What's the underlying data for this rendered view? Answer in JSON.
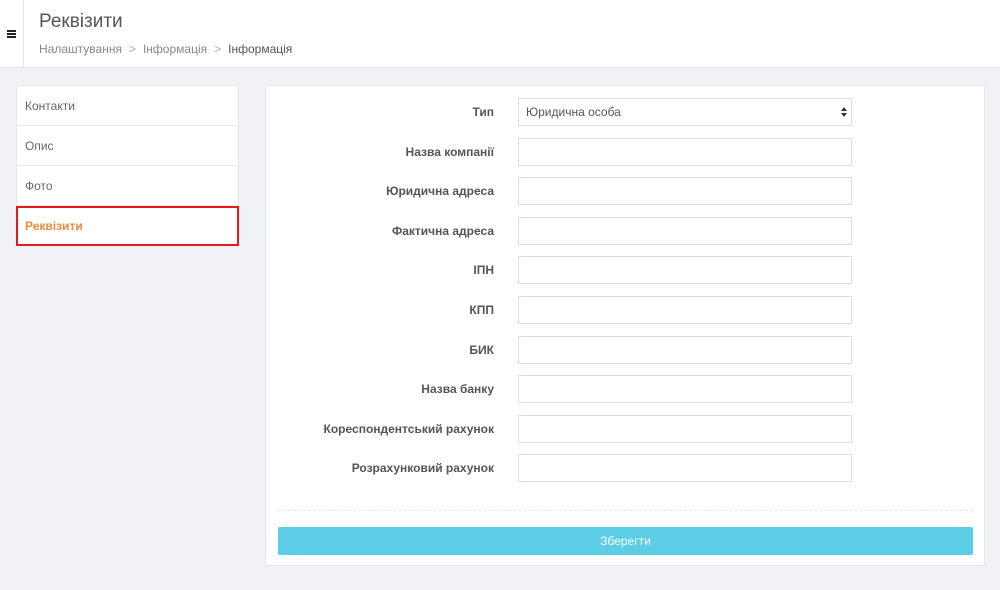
{
  "header": {
    "title": "Реквізити",
    "breadcrumb": [
      "Налаштування",
      "Інформація",
      "Інформація"
    ],
    "separator": ">",
    "menu_icon": "hamburger-icon"
  },
  "sidebar": {
    "items": [
      {
        "label": "Контакти",
        "active": false
      },
      {
        "label": "Опис",
        "active": false
      },
      {
        "label": "Фото",
        "active": false
      },
      {
        "label": "Реквізити",
        "active": true
      }
    ]
  },
  "form": {
    "type": {
      "label": "Тип",
      "value": "Юридична особа"
    },
    "fields": [
      {
        "label": "Назва компанії",
        "value": ""
      },
      {
        "label": "Юридична адреса",
        "value": ""
      },
      {
        "label": "Фактична адреса",
        "value": ""
      },
      {
        "label": "ІПН",
        "value": ""
      },
      {
        "label": "КПП",
        "value": ""
      },
      {
        "label": "БИК",
        "value": ""
      },
      {
        "label": "Назва банку",
        "value": ""
      },
      {
        "label": "Кореспондентський рахунок",
        "value": ""
      },
      {
        "label": "Розрахунковий рахунок",
        "value": ""
      }
    ],
    "save_label": "Зберегти"
  },
  "colors": {
    "accent": "#5bcee6",
    "active_text": "#f08a3c",
    "highlight_border": "#e3191b"
  }
}
